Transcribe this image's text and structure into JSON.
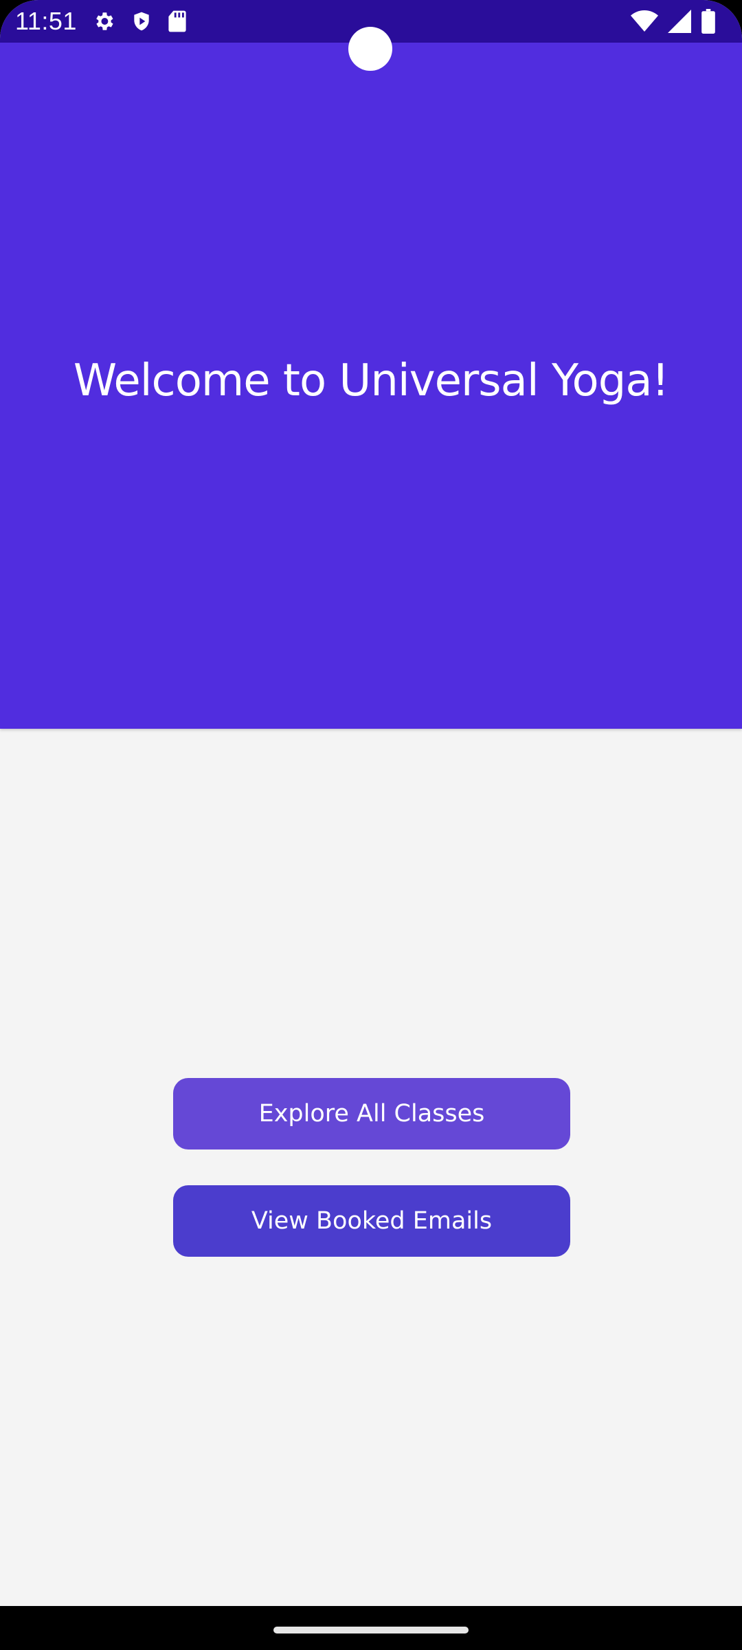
{
  "status_bar": {
    "time": "11:51",
    "left_icons": [
      "gear-icon",
      "shield-play-icon",
      "sd-card-icon"
    ],
    "right_icons": [
      "wifi-icon",
      "cell-signal-icon",
      "battery-icon"
    ]
  },
  "hero": {
    "title": "Welcome to Universal Yoga!",
    "background": "#512ddf"
  },
  "actions": {
    "explore_label": "Explore All Classes",
    "booked_label": "View Booked Emails"
  },
  "colors": {
    "status_bar": "#2a0d9a",
    "explore_button": "#6548d6",
    "booked_button": "#4b3dcd",
    "page_background": "#f4f4f4"
  }
}
